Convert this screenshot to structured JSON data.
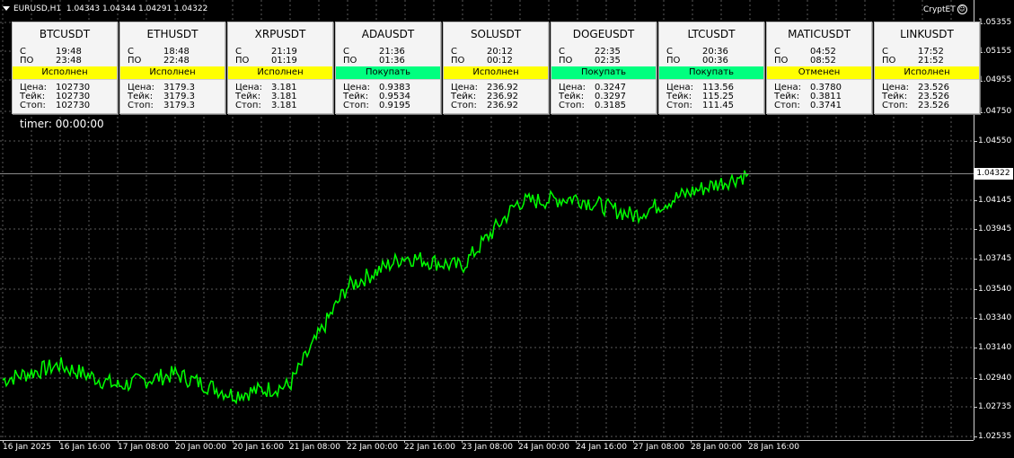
{
  "header": {
    "symbol": "EURUSD,H1",
    "ohlc": "1.04343 1.04344 1.04291 1.04322"
  },
  "brand": {
    "name": "CryptET",
    "icon": "smiley-icon"
  },
  "timer": "timer: 00:00:00",
  "price_axis": {
    "ticks": [
      "1.05355",
      "1.05155",
      "1.04955",
      "1.04750",
      "1.04550",
      "1.04145",
      "1.03945",
      "1.03745",
      "1.03540",
      "1.03340",
      "1.03140",
      "1.02940",
      "1.02735",
      "1.02535"
    ],
    "current": "1.04322"
  },
  "time_axis": {
    "ticks": [
      "16 Jan 2025",
      "16 Jan 16:00",
      "17 Jan 08:00",
      "20 Jan 00:00",
      "20 Jan 16:00",
      "21 Jan 08:00",
      "22 Jan 00:00",
      "22 Jan 16:00",
      "23 Jan 08:00",
      "24 Jan 00:00",
      "24 Jan 16:00",
      "27 Jan 08:00",
      "28 Jan 00:00",
      "28 Jan 16:00"
    ]
  },
  "labels": {
    "from": "С",
    "to": "ПО",
    "price": "Цена:",
    "take": "Тейк:",
    "stop": "Стоп:"
  },
  "cards": [
    {
      "symbol": "BTCUSDT",
      "from": "19:48",
      "to": "23:48",
      "status": "Исполнен",
      "status_type": "done",
      "price": "102730",
      "take": "102730",
      "stop": "102730"
    },
    {
      "symbol": "ETHUSDT",
      "from": "18:48",
      "to": "22:48",
      "status": "Исполнен",
      "status_type": "done",
      "price": "3179.3",
      "take": "3179.3",
      "stop": "3179.3"
    },
    {
      "symbol": "XRPUSDT",
      "from": "21:19",
      "to": "01:19",
      "status": "Исполнен",
      "status_type": "done",
      "price": "3.181",
      "take": "3.181",
      "stop": "3.181"
    },
    {
      "symbol": "ADAUSDT",
      "from": "21:36",
      "to": "01:36",
      "status": "Покупать",
      "status_type": "buy",
      "price": "0.9383",
      "take": "0.9534",
      "stop": "0.9195"
    },
    {
      "symbol": "SOLUSDT",
      "from": "20:12",
      "to": "00:12",
      "status": "Исполнен",
      "status_type": "done",
      "price": "236.92",
      "take": "236.92",
      "stop": "236.92"
    },
    {
      "symbol": "DOGEUSDT",
      "from": "22:35",
      "to": "02:35",
      "status": "Покупать",
      "status_type": "buy",
      "price": "0.3247",
      "take": "0.3297",
      "stop": "0.3185"
    },
    {
      "symbol": "LTCUSDT",
      "from": "20:36",
      "to": "00:36",
      "status": "Покупать",
      "status_type": "buy",
      "price": "113.56",
      "take": "115.25",
      "stop": "111.45"
    },
    {
      "symbol": "MATICUSDT",
      "from": "04:52",
      "to": "08:52",
      "status": "Отменен",
      "status_type": "cancel",
      "price": "0.3780",
      "take": "0.3811",
      "stop": "0.3741"
    },
    {
      "symbol": "LINKUSDT",
      "from": "17:52",
      "to": "21:52",
      "status": "Исполнен",
      "status_type": "done",
      "price": "23.526",
      "take": "23.526",
      "stop": "23.526"
    }
  ],
  "chart_data": {
    "type": "line",
    "symbol": "EURUSD",
    "timeframe": "H1",
    "series_color": "#00ff00",
    "grid": true,
    "grid_style": "dashed",
    "background": "#000000",
    "x": [
      "16 Jan 2025",
      "16 Jan 16:00",
      "17 Jan 08:00",
      "20 Jan 00:00",
      "20 Jan 16:00",
      "21 Jan 08:00",
      "22 Jan 00:00",
      "22 Jan 16:00",
      "23 Jan 08:00",
      "24 Jan 00:00",
      "24 Jan 16:00",
      "27 Jan 08:00",
      "28 Jan 00:00",
      "28 Jan 16:00"
    ],
    "values": [
      1.0292,
      1.0302,
      1.0288,
      1.0296,
      1.0282,
      1.0288,
      1.0355,
      1.0376,
      1.0369,
      1.0413,
      1.0416,
      1.0404,
      1.042,
      1.0432
    ],
    "ylim": [
      1.02535,
      1.05355
    ],
    "current_price": 1.04322
  }
}
